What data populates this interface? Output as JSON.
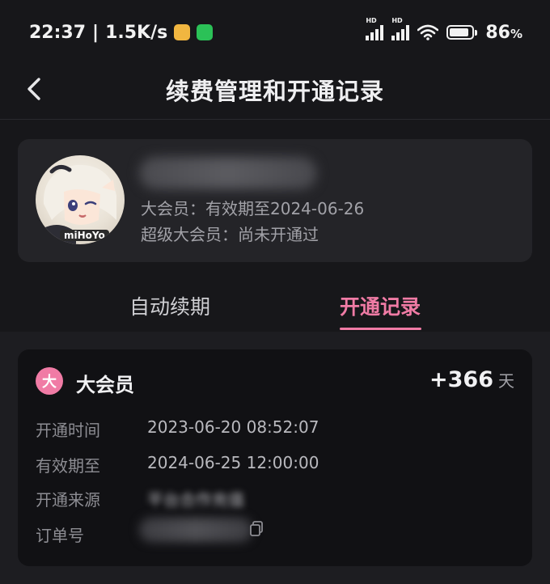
{
  "statusbar": {
    "time": "22:37",
    "separator": "|",
    "net_speed": "1.5K/s",
    "battery": "86",
    "battery_unit": "%",
    "battery_level": 0.86,
    "signal_label": "HD"
  },
  "header": {
    "title": "续费管理和开通记录"
  },
  "profile": {
    "avatar_brand": "miHoYo",
    "vip_status": "大会员：有效期至2024-06-26",
    "super_vip_status": "超级大会员：尚未开通过"
  },
  "tabs": [
    {
      "label": "自动续期",
      "active": false
    },
    {
      "label": "开通记录",
      "active": true
    }
  ],
  "record": {
    "badge": "大",
    "name": "大会员",
    "days": "+366",
    "days_unit": "天",
    "rows": [
      {
        "label": "开通时间",
        "value": "2023-06-20 08:52:07"
      },
      {
        "label": "有效期至",
        "value": "2024-06-25 12:00:00"
      },
      {
        "label": "开通来源",
        "value": "平台合作充值"
      },
      {
        "label": "订单号",
        "value": ""
      }
    ]
  },
  "colors": {
    "accent": "#f07ba5",
    "background": "#17171a",
    "card": "#242428",
    "record_card": "#111114"
  }
}
